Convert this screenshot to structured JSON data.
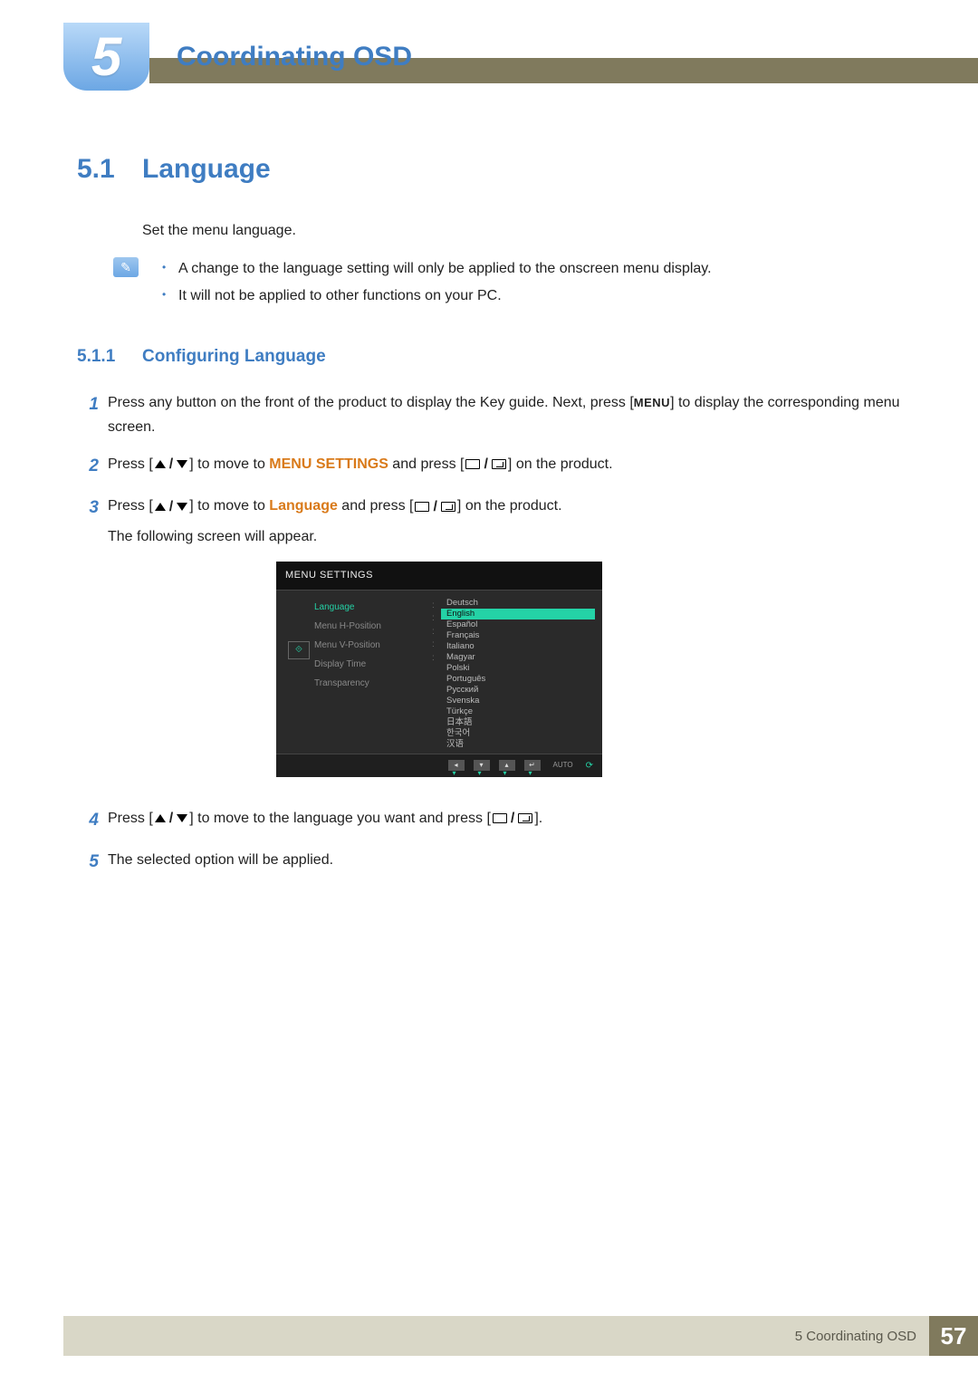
{
  "chapter": {
    "number": "5",
    "title": "Coordinating OSD"
  },
  "section": {
    "number": "5.1",
    "title": "Language"
  },
  "intro": "Set the menu language.",
  "notes": [
    "A change to the language setting will only be applied to the onscreen menu display.",
    "It will not be applied to other functions on your PC."
  ],
  "subsection": {
    "number": "5.1.1",
    "title": "Configuring Language"
  },
  "steps": {
    "s1a": "Press any button on the front of the product to display the Key guide. Next, press [",
    "s1_menu": "MENU",
    "s1b": "] to display the corresponding menu screen.",
    "s2a": "Press [",
    "s2b": "] to move to ",
    "s2_menu": "MENU SETTINGS",
    "s2c": " and press [",
    "s2d": "] on the product.",
    "s3a": "Press [",
    "s3b": "] to move to ",
    "s3_lang": "Language",
    "s3c": " and press [",
    "s3d": "] on the product.",
    "s3_appear": "The following screen will appear.",
    "s4a": "Press [",
    "s4b": "] to move to the language you want and press [",
    "s4c": "].",
    "s5": "The selected option will be applied."
  },
  "osd": {
    "header": "MENU SETTINGS",
    "menu_items": [
      "Language",
      "Menu H-Position",
      "Menu V-Position",
      "Display Time",
      "Transparency"
    ],
    "languages": [
      "Deutsch",
      "English",
      "Español",
      "Français",
      "Italiano",
      "Magyar",
      "Polski",
      "Português",
      "Русский",
      "Svenska",
      "Türkçe",
      "日本語",
      "한국어",
      "汉语"
    ],
    "selected_language": "English",
    "footer_auto": "AUTO"
  },
  "footer": {
    "text": "5 Coordinating OSD",
    "page": "57"
  }
}
